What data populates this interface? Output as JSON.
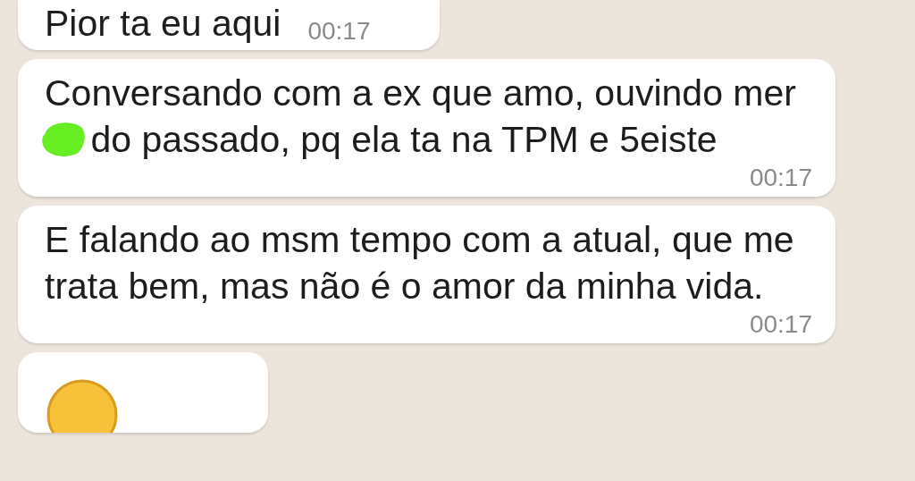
{
  "messages": [
    {
      "segments": [
        {
          "kind": "text",
          "text": "Pior ta eu aqui"
        }
      ],
      "time": "00:17",
      "inline_time": true
    },
    {
      "segments": [
        {
          "kind": "text",
          "text": "Conversando com a ex que amo, ouvindo mer"
        },
        {
          "kind": "censor"
        },
        {
          "kind": "text",
          "text": " do passado, pq ela ta na TPM e 5eiste"
        }
      ],
      "time": "00:17",
      "inline_time": false
    },
    {
      "segments": [
        {
          "kind": "text",
          "text": "E falando ao msm tempo com a atual, que me trata bem, mas não é o amor da minha vida."
        }
      ],
      "time": "00:17",
      "inline_time": false
    },
    {
      "segments": [
        {
          "kind": "emoji"
        }
      ]
    }
  ]
}
